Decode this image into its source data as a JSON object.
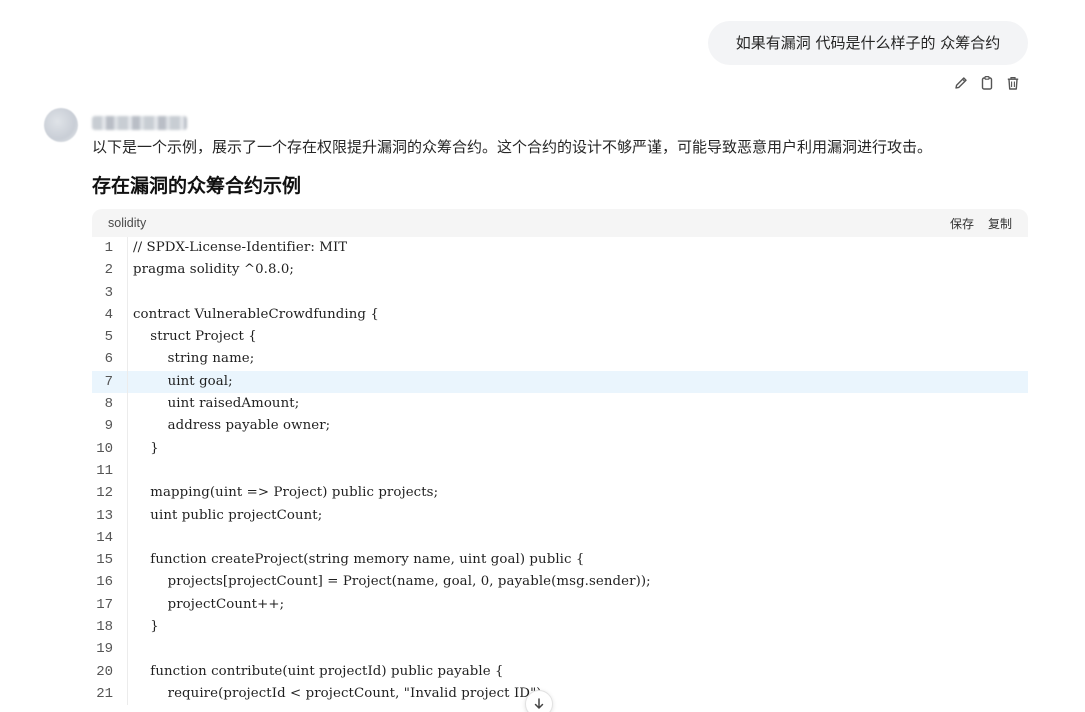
{
  "user_message": {
    "text": "如果有漏洞 代码是什么样子的 众筹合约",
    "actions": [
      {
        "icon": "pencil-icon"
      },
      {
        "icon": "copy-icon"
      },
      {
        "icon": "trash-icon"
      }
    ]
  },
  "assistant": {
    "intro": "以下是一个示例，展示了一个存在权限提升漏洞的众筹合约。这个合约的设计不够严谨，可能导致恶意用户利用漏洞进行攻击。",
    "section_title": "存在漏洞的众筹合约示例"
  },
  "code_block": {
    "language": "solidity",
    "save_label": "保存",
    "copy_label": "复制",
    "highlighted_line": 7,
    "lines": [
      {
        "n": "1",
        "t": "// SPDX-License-Identifier: MIT"
      },
      {
        "n": "2",
        "t": "pragma solidity ^0.8.0;"
      },
      {
        "n": "3",
        "t": ""
      },
      {
        "n": "4",
        "t": "contract VulnerableCrowdfunding {"
      },
      {
        "n": "5",
        "t": "    struct Project {"
      },
      {
        "n": "6",
        "t": "        string name;"
      },
      {
        "n": "7",
        "t": "        uint goal;"
      },
      {
        "n": "8",
        "t": "        uint raisedAmount;"
      },
      {
        "n": "9",
        "t": "        address payable owner;"
      },
      {
        "n": "10",
        "t": "    }"
      },
      {
        "n": "11",
        "t": ""
      },
      {
        "n": "12",
        "t": "    mapping(uint => Project) public projects;"
      },
      {
        "n": "13",
        "t": "    uint public projectCount;"
      },
      {
        "n": "14",
        "t": ""
      },
      {
        "n": "15",
        "t": "    function createProject(string memory name, uint goal) public {"
      },
      {
        "n": "16",
        "t": "        projects[projectCount] = Project(name, goal, 0, payable(msg.sender));"
      },
      {
        "n": "17",
        "t": "        projectCount++;"
      },
      {
        "n": "18",
        "t": "    }"
      },
      {
        "n": "19",
        "t": ""
      },
      {
        "n": "20",
        "t": "    function contribute(uint projectId) public payable {"
      },
      {
        "n": "21",
        "t": "        require(projectId < projectCount, \"Invalid project ID\");"
      }
    ]
  },
  "scroll_button": {
    "icon": "arrow-down-icon"
  }
}
